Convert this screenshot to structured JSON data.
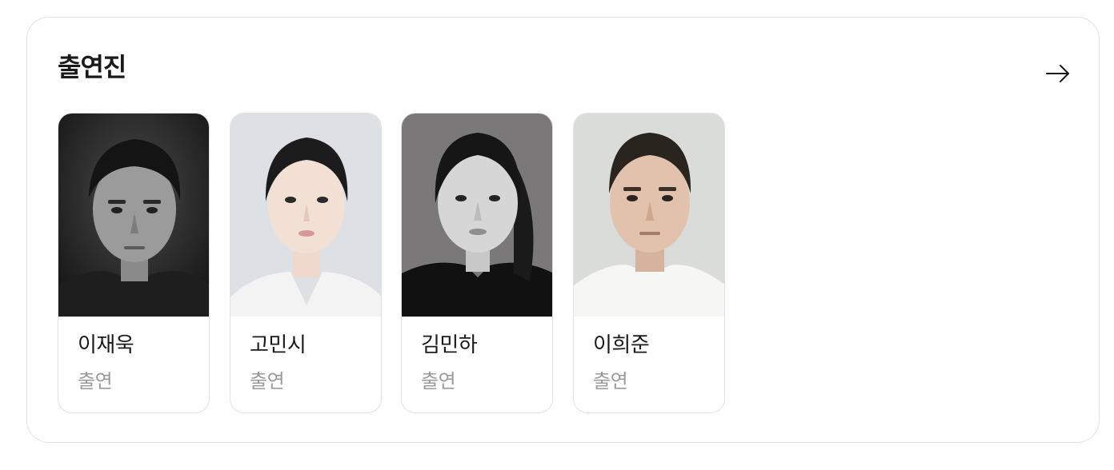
{
  "section": {
    "title": "출연진",
    "more_icon": "arrow-right-icon"
  },
  "cast": [
    {
      "name": "이재욱",
      "role": "출연",
      "photo_tone": "#2b2b2b"
    },
    {
      "name": "고민시",
      "role": "출연",
      "photo_tone": "#d9dde2"
    },
    {
      "name": "김민하",
      "role": "출연",
      "photo_tone": "#6e6c6c"
    },
    {
      "name": "이희준",
      "role": "출연",
      "photo_tone": "#d7dad6"
    }
  ]
}
